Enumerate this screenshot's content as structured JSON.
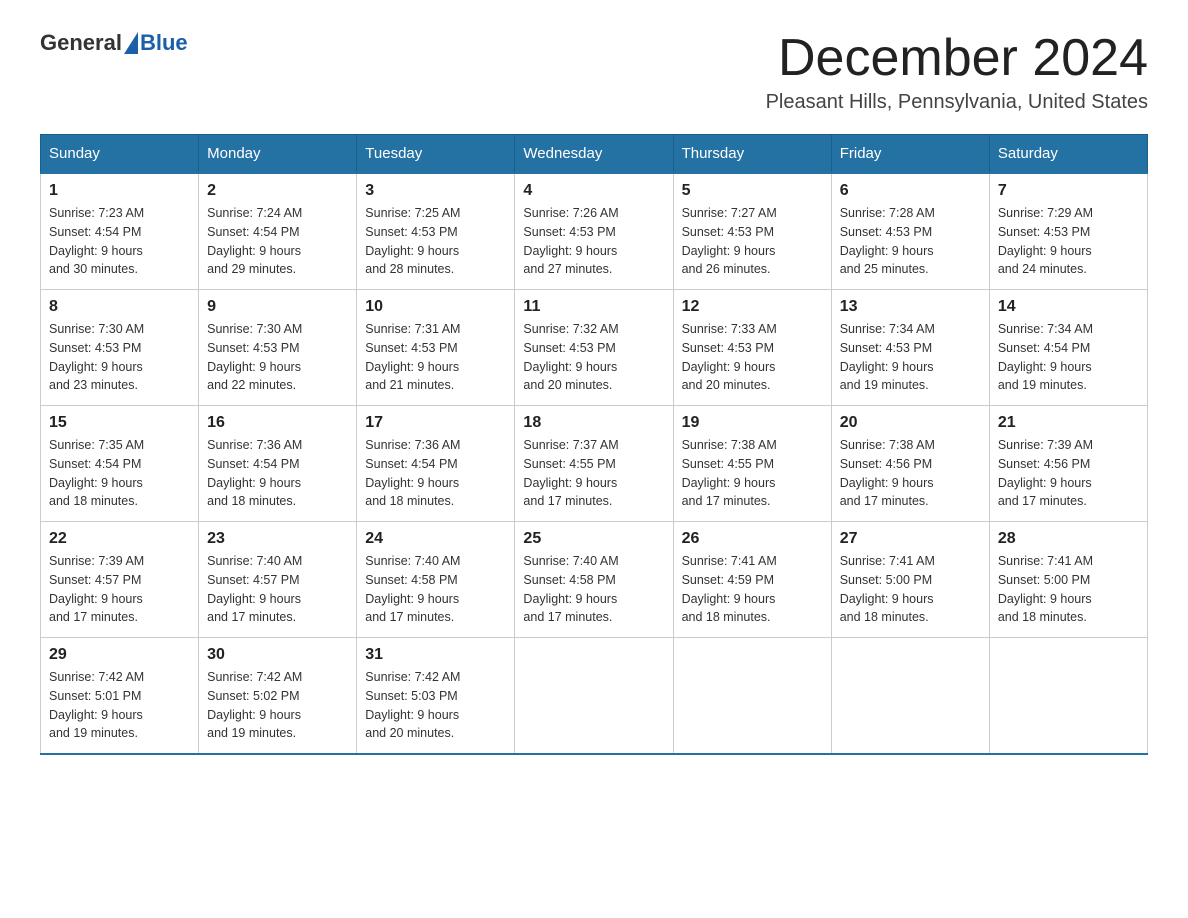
{
  "logo": {
    "general": "General",
    "blue": "Blue"
  },
  "title": "December 2024",
  "location": "Pleasant Hills, Pennsylvania, United States",
  "days_of_week": [
    "Sunday",
    "Monday",
    "Tuesday",
    "Wednesday",
    "Thursday",
    "Friday",
    "Saturday"
  ],
  "weeks": [
    [
      {
        "day": "1",
        "sunrise": "7:23 AM",
        "sunset": "4:54 PM",
        "daylight": "9 hours and 30 minutes."
      },
      {
        "day": "2",
        "sunrise": "7:24 AM",
        "sunset": "4:54 PM",
        "daylight": "9 hours and 29 minutes."
      },
      {
        "day": "3",
        "sunrise": "7:25 AM",
        "sunset": "4:53 PM",
        "daylight": "9 hours and 28 minutes."
      },
      {
        "day": "4",
        "sunrise": "7:26 AM",
        "sunset": "4:53 PM",
        "daylight": "9 hours and 27 minutes."
      },
      {
        "day": "5",
        "sunrise": "7:27 AM",
        "sunset": "4:53 PM",
        "daylight": "9 hours and 26 minutes."
      },
      {
        "day": "6",
        "sunrise": "7:28 AM",
        "sunset": "4:53 PM",
        "daylight": "9 hours and 25 minutes."
      },
      {
        "day": "7",
        "sunrise": "7:29 AM",
        "sunset": "4:53 PM",
        "daylight": "9 hours and 24 minutes."
      }
    ],
    [
      {
        "day": "8",
        "sunrise": "7:30 AM",
        "sunset": "4:53 PM",
        "daylight": "9 hours and 23 minutes."
      },
      {
        "day": "9",
        "sunrise": "7:30 AM",
        "sunset": "4:53 PM",
        "daylight": "9 hours and 22 minutes."
      },
      {
        "day": "10",
        "sunrise": "7:31 AM",
        "sunset": "4:53 PM",
        "daylight": "9 hours and 21 minutes."
      },
      {
        "day": "11",
        "sunrise": "7:32 AM",
        "sunset": "4:53 PM",
        "daylight": "9 hours and 20 minutes."
      },
      {
        "day": "12",
        "sunrise": "7:33 AM",
        "sunset": "4:53 PM",
        "daylight": "9 hours and 20 minutes."
      },
      {
        "day": "13",
        "sunrise": "7:34 AM",
        "sunset": "4:53 PM",
        "daylight": "9 hours and 19 minutes."
      },
      {
        "day": "14",
        "sunrise": "7:34 AM",
        "sunset": "4:54 PM",
        "daylight": "9 hours and 19 minutes."
      }
    ],
    [
      {
        "day": "15",
        "sunrise": "7:35 AM",
        "sunset": "4:54 PM",
        "daylight": "9 hours and 18 minutes."
      },
      {
        "day": "16",
        "sunrise": "7:36 AM",
        "sunset": "4:54 PM",
        "daylight": "9 hours and 18 minutes."
      },
      {
        "day": "17",
        "sunrise": "7:36 AM",
        "sunset": "4:54 PM",
        "daylight": "9 hours and 18 minutes."
      },
      {
        "day": "18",
        "sunrise": "7:37 AM",
        "sunset": "4:55 PM",
        "daylight": "9 hours and 17 minutes."
      },
      {
        "day": "19",
        "sunrise": "7:38 AM",
        "sunset": "4:55 PM",
        "daylight": "9 hours and 17 minutes."
      },
      {
        "day": "20",
        "sunrise": "7:38 AM",
        "sunset": "4:56 PM",
        "daylight": "9 hours and 17 minutes."
      },
      {
        "day": "21",
        "sunrise": "7:39 AM",
        "sunset": "4:56 PM",
        "daylight": "9 hours and 17 minutes."
      }
    ],
    [
      {
        "day": "22",
        "sunrise": "7:39 AM",
        "sunset": "4:57 PM",
        "daylight": "9 hours and 17 minutes."
      },
      {
        "day": "23",
        "sunrise": "7:40 AM",
        "sunset": "4:57 PM",
        "daylight": "9 hours and 17 minutes."
      },
      {
        "day": "24",
        "sunrise": "7:40 AM",
        "sunset": "4:58 PM",
        "daylight": "9 hours and 17 minutes."
      },
      {
        "day": "25",
        "sunrise": "7:40 AM",
        "sunset": "4:58 PM",
        "daylight": "9 hours and 17 minutes."
      },
      {
        "day": "26",
        "sunrise": "7:41 AM",
        "sunset": "4:59 PM",
        "daylight": "9 hours and 18 minutes."
      },
      {
        "day": "27",
        "sunrise": "7:41 AM",
        "sunset": "5:00 PM",
        "daylight": "9 hours and 18 minutes."
      },
      {
        "day": "28",
        "sunrise": "7:41 AM",
        "sunset": "5:00 PM",
        "daylight": "9 hours and 18 minutes."
      }
    ],
    [
      {
        "day": "29",
        "sunrise": "7:42 AM",
        "sunset": "5:01 PM",
        "daylight": "9 hours and 19 minutes."
      },
      {
        "day": "30",
        "sunrise": "7:42 AM",
        "sunset": "5:02 PM",
        "daylight": "9 hours and 19 minutes."
      },
      {
        "day": "31",
        "sunrise": "7:42 AM",
        "sunset": "5:03 PM",
        "daylight": "9 hours and 20 minutes."
      },
      null,
      null,
      null,
      null
    ]
  ],
  "labels": {
    "sunrise": "Sunrise:",
    "sunset": "Sunset:",
    "daylight": "Daylight:"
  }
}
